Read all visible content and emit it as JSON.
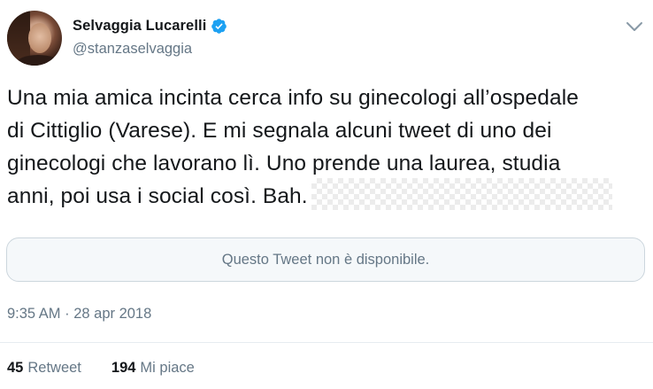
{
  "user": {
    "display_name": "Selvaggia Lucarelli",
    "handle": "@stanzaselvaggia",
    "verified": true,
    "avatar_icon": "profile-photo"
  },
  "tweet": {
    "text_lines": [
      "Una mia amica incinta cerca info su ginecologi all’ospedale",
      "di Cittiglio (Varese). E mi segnala alcuni tweet di uno dei",
      "ginecologi che lavorano lì. Uno prende una laurea, studia",
      "anni, poi usa i social così. Bah."
    ],
    "quoted_unavailable": "Questo Tweet non è disponibile.",
    "timestamp": "9:35 AM · 28 apr 2018"
  },
  "stats": {
    "retweets_count": "45",
    "retweets_label": "Retweet",
    "likes_count": "194",
    "likes_label": "Mi piace"
  },
  "colors": {
    "verified_blue": "#1da1f2",
    "secondary_text": "#657786",
    "primary_text": "#14171a",
    "border": "#ccd6dd"
  }
}
